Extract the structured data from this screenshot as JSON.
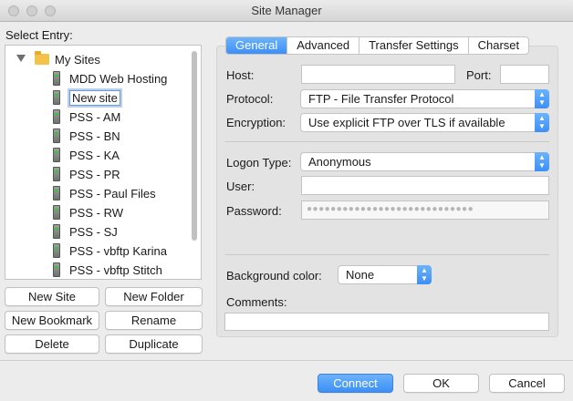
{
  "window": {
    "title": "Site Manager"
  },
  "tree": {
    "heading": "Select Entry:",
    "root": "My Sites",
    "sites": [
      "MDD Web Hosting",
      "New site",
      "PSS - AM",
      "PSS - BN",
      "PSS - KA",
      "PSS - PR",
      "PSS - Paul Files",
      "PSS - RW",
      "PSS - SJ",
      "PSS - vbftp Karina",
      "PSS - vbftp Stitch"
    ],
    "editing_text": "New site"
  },
  "left_buttons": {
    "new_site": "New Site",
    "new_folder": "New Folder",
    "new_bookmark": "New Bookmark",
    "rename": "Rename",
    "delete": "Delete",
    "duplicate": "Duplicate"
  },
  "tabs": [
    "General",
    "Advanced",
    "Transfer Settings",
    "Charset"
  ],
  "form": {
    "host_label": "Host:",
    "host_value": "",
    "port_label": "Port:",
    "port_value": "",
    "protocol_label": "Protocol:",
    "protocol_value": "FTP - File Transfer Protocol",
    "encryption_label": "Encryption:",
    "encryption_value": "Use explicit FTP over TLS if available",
    "logon_label": "Logon Type:",
    "logon_value": "Anonymous",
    "user_label": "User:",
    "user_value": "",
    "password_label": "Password:",
    "password_mask": "●●●●●●●●●●●●●●●●●●●●●●●●●●●●",
    "bgcolor_label": "Background color:",
    "bgcolor_value": "None",
    "comments_label": "Comments:"
  },
  "footer": {
    "connect": "Connect",
    "ok": "OK",
    "cancel": "Cancel"
  },
  "colors": {
    "accent": "#3d8ff7",
    "folder": "#f3c24a"
  }
}
